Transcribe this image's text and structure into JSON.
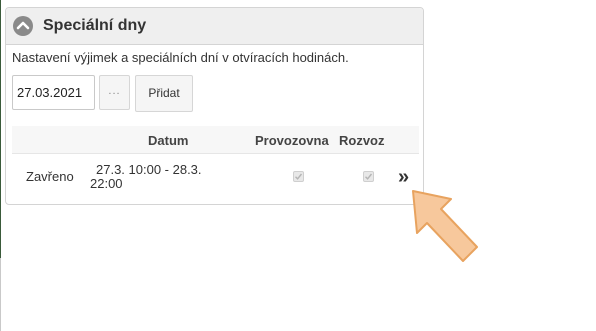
{
  "panel": {
    "title": "Speciální dny",
    "description": "Nastavení výjimek a speciálních dní v otvíracích hodinách.",
    "date_value": "27.03.2021",
    "browse_label": "...",
    "add_label": "Přidat"
  },
  "table": {
    "columns": [
      "",
      "Datum",
      "Provozovna",
      "Rozvoz",
      ""
    ],
    "rows": [
      {
        "type": "Zavřeno",
        "range": "27.3. 10:00 - 28.3. 22:00",
        "provozovna_checked": true,
        "rozvoz_checked": true,
        "action_icon": "double-chevron-right-icon"
      }
    ]
  },
  "colors": {
    "header_bg": "#efefef",
    "border": "#d4d4d4",
    "pointer_fill": "#f7c89c",
    "pointer_stroke": "#e8a35f"
  }
}
